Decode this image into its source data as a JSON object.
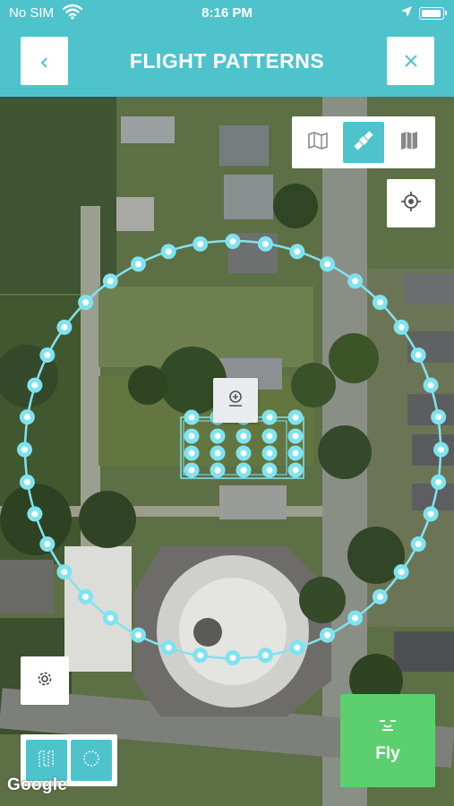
{
  "status_bar": {
    "carrier": "No SIM",
    "time": "8:16 PM"
  },
  "header": {
    "title": "FLIGHT PATTERNS",
    "back_icon": "chevron-left-icon",
    "close_icon": "close-icon"
  },
  "map_type_selector": {
    "options": [
      "map-icon",
      "satellite-icon",
      "terrain-map-icon"
    ],
    "selected": "satellite-icon"
  },
  "pattern_selector": {
    "options": [
      "lawnmower-pattern-icon",
      "orbit-pattern-icon"
    ]
  },
  "fly_button": {
    "label": "Fly"
  },
  "attribution": {
    "text": "Google"
  },
  "colors": {
    "accent": "#4fc3cc",
    "fly": "#5ccf6e",
    "waypoint": "#7fe3f0"
  }
}
